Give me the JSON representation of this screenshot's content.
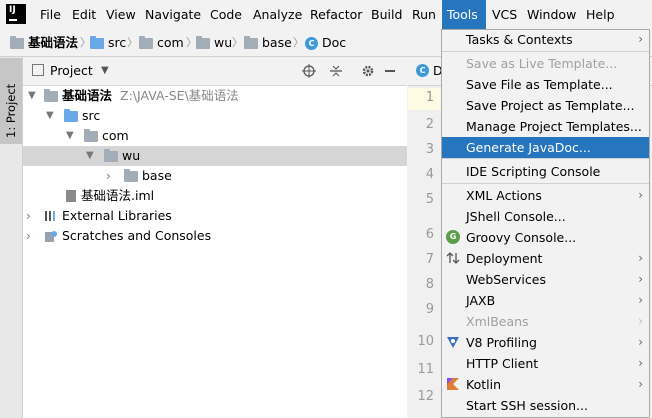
{
  "menubar": {
    "items": [
      "File",
      "Edit",
      "View",
      "Navigate",
      "Code",
      "Analyze",
      "Refactor",
      "Build",
      "Run",
      "Tools",
      "VCS",
      "Window",
      "Help"
    ],
    "active": "Tools"
  },
  "breadcrumb": [
    "基础语法",
    "src",
    "com",
    "wu",
    "base",
    "Doc"
  ],
  "side_tab": "1: Project",
  "project_panel": {
    "title": "Project",
    "tree": [
      {
        "label": "基础语法",
        "path": "Z:\\JAVA-SE\\基础语法"
      },
      {
        "label": "src"
      },
      {
        "label": "com"
      },
      {
        "label": "wu"
      },
      {
        "label": "base"
      },
      {
        "label": "基础语法.iml"
      },
      {
        "label": "External Libraries"
      },
      {
        "label": "Scratches and Consoles"
      }
    ]
  },
  "editor": {
    "tab_label": "D",
    "line_numbers": [
      "1",
      "2",
      "3",
      "4",
      "5",
      "6",
      "7",
      "8",
      "9",
      "10",
      "11",
      "12"
    ]
  },
  "tools_menu": {
    "items": [
      {
        "label": "Tasks & Contexts",
        "submenu": true
      },
      {
        "label": "Save as Live Template...",
        "disabled": true
      },
      {
        "label": "Save File as Template..."
      },
      {
        "label": "Save Project as Template..."
      },
      {
        "label": "Manage Project Templates..."
      },
      {
        "label": "Generate JavaDoc...",
        "highlighted": true
      },
      {
        "label": "IDE Scripting Console"
      },
      {
        "label": "XML Actions",
        "submenu": true
      },
      {
        "label": "JShell Console..."
      },
      {
        "label": "Groovy Console..."
      },
      {
        "label": "Deployment",
        "submenu": true
      },
      {
        "label": "WebServices",
        "submenu": true
      },
      {
        "label": "JAXB",
        "submenu": true
      },
      {
        "label": "XmlBeans",
        "submenu": true,
        "disabled": true
      },
      {
        "label": "V8 Profiling",
        "submenu": true
      },
      {
        "label": "HTTP Client",
        "submenu": true
      },
      {
        "label": "Kotlin",
        "submenu": true
      },
      {
        "label": "Start SSH session..."
      }
    ]
  },
  "colors": {
    "accent": "#2675bf",
    "selection": "#d5d5d5",
    "folder_blue": "#6aa9e8"
  }
}
